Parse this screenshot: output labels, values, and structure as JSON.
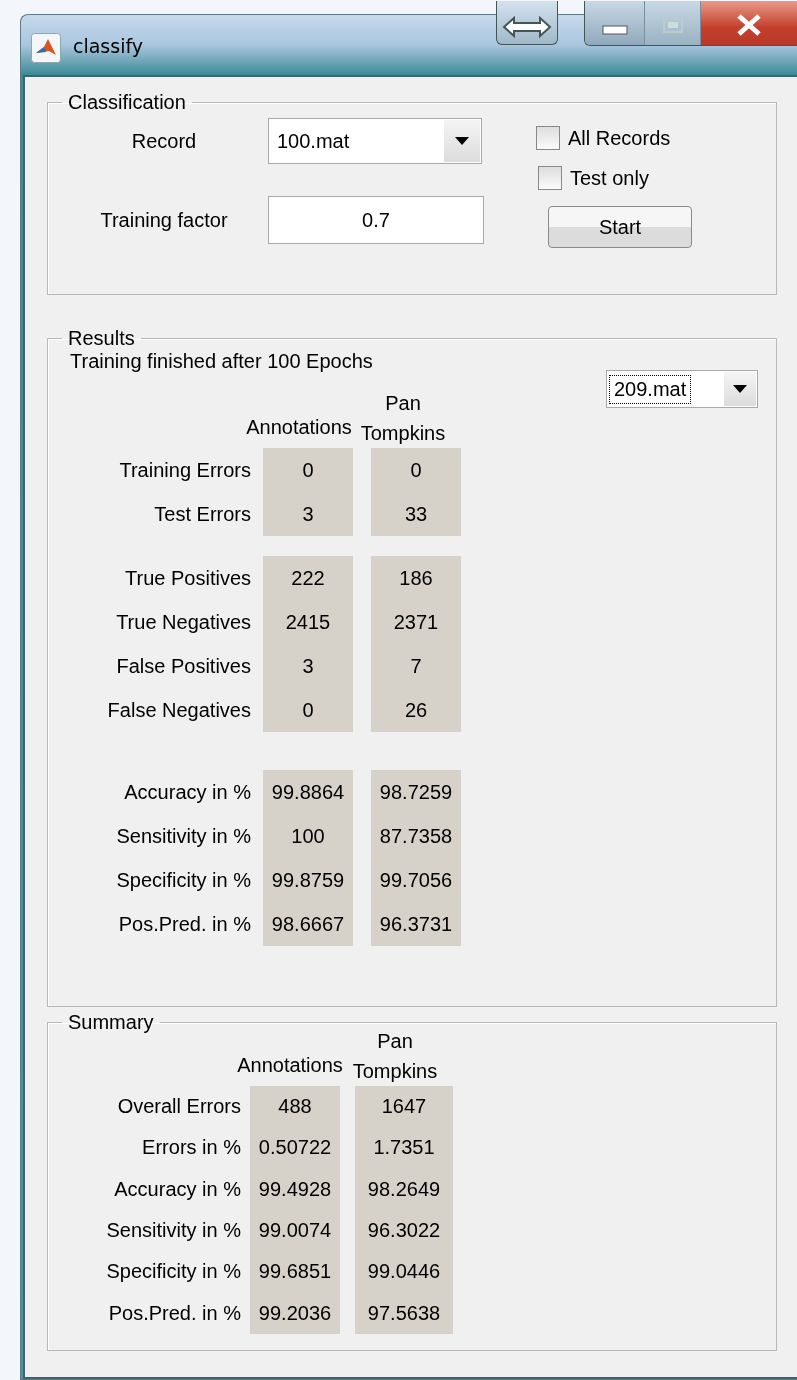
{
  "window": {
    "title": "classify"
  },
  "classification": {
    "legend": "Classification",
    "record_label": "Record",
    "record_value": "100.mat",
    "factor_label": "Training factor",
    "factor_value": "0.7",
    "checkboxes": [
      {
        "label": "All Records",
        "checked": false
      },
      {
        "label": "Test only",
        "checked": false
      }
    ],
    "start_button": "Start"
  },
  "results": {
    "legend": "Results",
    "status": "Training finished after 100 Epochs",
    "record_value": "209.mat",
    "columns": [
      "Annotations",
      "Pan Tompkins"
    ],
    "groups": [
      {
        "rows": [
          {
            "label": "Training Errors",
            "values": [
              "0",
              "0"
            ]
          },
          {
            "label": "Test Errors",
            "values": [
              "3",
              "33"
            ]
          }
        ]
      },
      {
        "rows": [
          {
            "label": "True Positives",
            "values": [
              "222",
              "186"
            ]
          },
          {
            "label": "True Negatives",
            "values": [
              "2415",
              "2371"
            ]
          },
          {
            "label": "False Positives",
            "values": [
              "3",
              "7"
            ]
          },
          {
            "label": "False Negatives",
            "values": [
              "0",
              "26"
            ]
          }
        ]
      },
      {
        "rows": [
          {
            "label": "Accuracy in %",
            "values": [
              "99.8864",
              "98.7259"
            ]
          },
          {
            "label": "Sensitivity in %",
            "values": [
              "100",
              "87.7358"
            ]
          },
          {
            "label": "Specificity in %",
            "values": [
              "99.8759",
              "99.7056"
            ]
          },
          {
            "label": "Pos.Pred. in %",
            "values": [
              "98.6667",
              "96.3731"
            ]
          }
        ]
      }
    ]
  },
  "summary": {
    "legend": "Summary",
    "columns": [
      "Annotations",
      "Pan Tompkins"
    ],
    "rows": [
      {
        "label": "Overall Errors",
        "values": [
          "488",
          "1647"
        ]
      },
      {
        "label": "Errors in %",
        "values": [
          "0.50722",
          "1.7351"
        ]
      },
      {
        "label": "Accuracy in %",
        "values": [
          "99.4928",
          "98.2649"
        ]
      },
      {
        "label": "Sensitivity in %",
        "values": [
          "99.0074",
          "96.3022"
        ]
      },
      {
        "label": "Specificity in %",
        "values": [
          "99.6851",
          "99.0446"
        ]
      },
      {
        "label": "Pos.Pred. in %",
        "values": [
          "99.2036",
          "97.5638"
        ]
      }
    ]
  }
}
